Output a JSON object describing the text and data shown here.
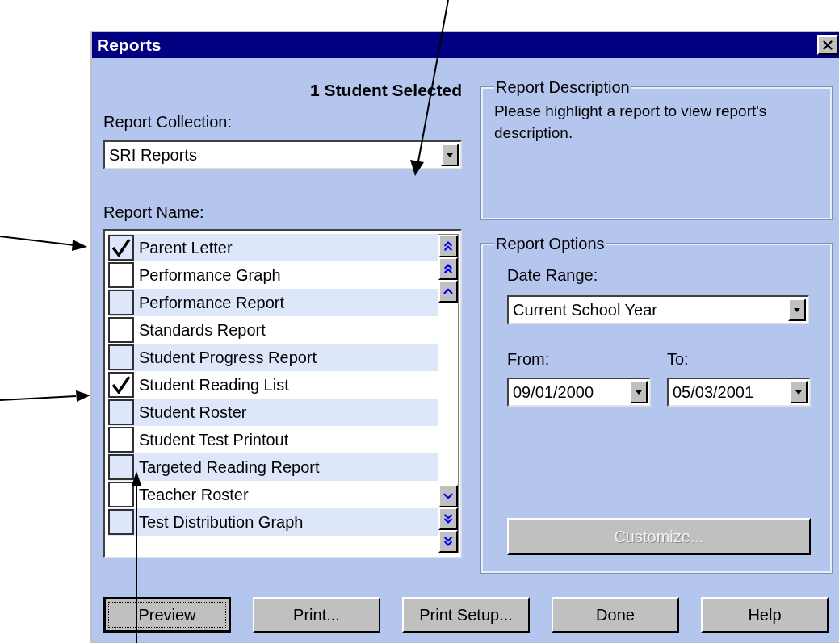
{
  "window": {
    "title": "Reports"
  },
  "selection_count": "1 Student Selected",
  "report_collection": {
    "label": "Report Collection:",
    "value": "SRI Reports"
  },
  "report_name": {
    "label": "Report Name:",
    "items": [
      {
        "label": "Parent Letter",
        "checked": true
      },
      {
        "label": "Performance Graph",
        "checked": false
      },
      {
        "label": "Performance Report",
        "checked": false
      },
      {
        "label": "Standards Report",
        "checked": false
      },
      {
        "label": "Student Progress Report",
        "checked": false
      },
      {
        "label": "Student Reading List",
        "checked": true
      },
      {
        "label": "Student Roster",
        "checked": false
      },
      {
        "label": "Student Test Printout",
        "checked": false
      },
      {
        "label": "Targeted Reading Report",
        "checked": false
      },
      {
        "label": "Teacher Roster",
        "checked": false
      },
      {
        "label": "Test Distribution Graph",
        "checked": false
      }
    ]
  },
  "report_description": {
    "title": "Report Description",
    "text": "Please highlight a report to view report's description."
  },
  "report_options": {
    "title": "Report Options",
    "date_range": {
      "label": "Date Range:",
      "value": "Current School Year"
    },
    "from": {
      "label": "From:",
      "value": "09/01/2000"
    },
    "to": {
      "label": "To:",
      "value": "05/03/2001"
    },
    "customize": {
      "label": "Customize...",
      "disabled": true
    }
  },
  "buttons": [
    {
      "label": "Preview",
      "default": true
    },
    {
      "label": "Print...",
      "default": false
    },
    {
      "label": "Print Setup...",
      "default": false
    },
    {
      "label": "Done",
      "default": false
    },
    {
      "label": "Help",
      "default": false
    }
  ]
}
